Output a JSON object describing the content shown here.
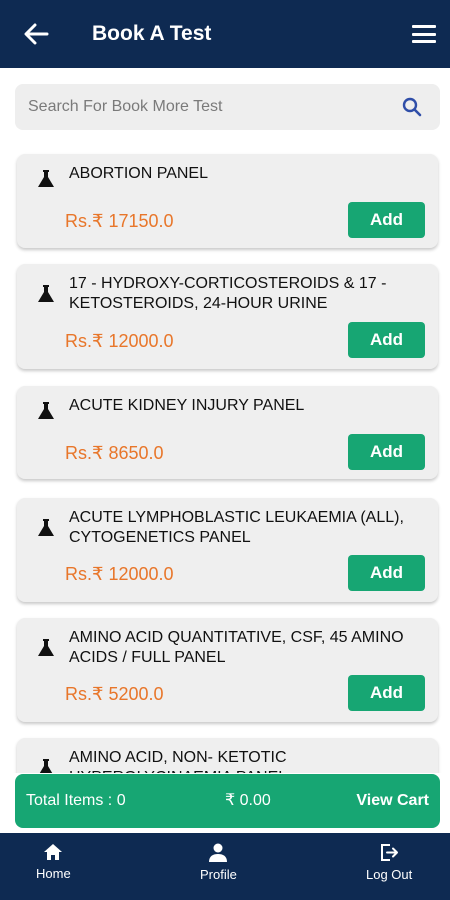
{
  "header": {
    "title": "Book A Test",
    "back_icon": "arrow-left-icon",
    "menu_icon": "hamburger-menu-icon"
  },
  "search": {
    "placeholder": "Search For Book More Test",
    "value": "",
    "icon": "search-icon"
  },
  "tests": [
    {
      "name": "ABORTION PANEL",
      "price": "Rs.₹ 17150.0",
      "add_label": "Add"
    },
    {
      "name": "17 - HYDROXY-CORTICOSTEROIDS & 17 - KETOSTEROIDS, 24-HOUR URINE",
      "price": "Rs.₹ 12000.0",
      "add_label": "Add"
    },
    {
      "name": "ACUTE KIDNEY INJURY PANEL",
      "price": "Rs.₹ 8650.0",
      "add_label": "Add"
    },
    {
      "name": "ACUTE LYMPHOBLASTIC LEUKAEMIA (ALL), CYTOGENETICS PANEL",
      "price": "Rs.₹ 12000.0",
      "add_label": "Add"
    },
    {
      "name": "AMINO ACID QUANTITATIVE, CSF, 45 AMINO ACIDS / FULL PANEL",
      "price": "Rs.₹ 5200.0",
      "add_label": "Add"
    },
    {
      "name": "AMINO ACID, NON- KETOTIC HYPERGLYCINAEMIA PANEL",
      "price": "",
      "add_label": ""
    }
  ],
  "cart": {
    "total_label": "Total Items :  0",
    "amount": "₹  0.00",
    "view_label": "View Cart"
  },
  "bottom_nav": {
    "home": {
      "label": "Home",
      "icon": "home-icon"
    },
    "profile": {
      "label": "Profile",
      "icon": "person-icon"
    },
    "logout": {
      "label": "Log Out",
      "icon": "logout-icon"
    }
  },
  "colors": {
    "primary": "#0e2a52",
    "accent": "#17a673",
    "price": "#e8762a",
    "card": "#efefef"
  }
}
